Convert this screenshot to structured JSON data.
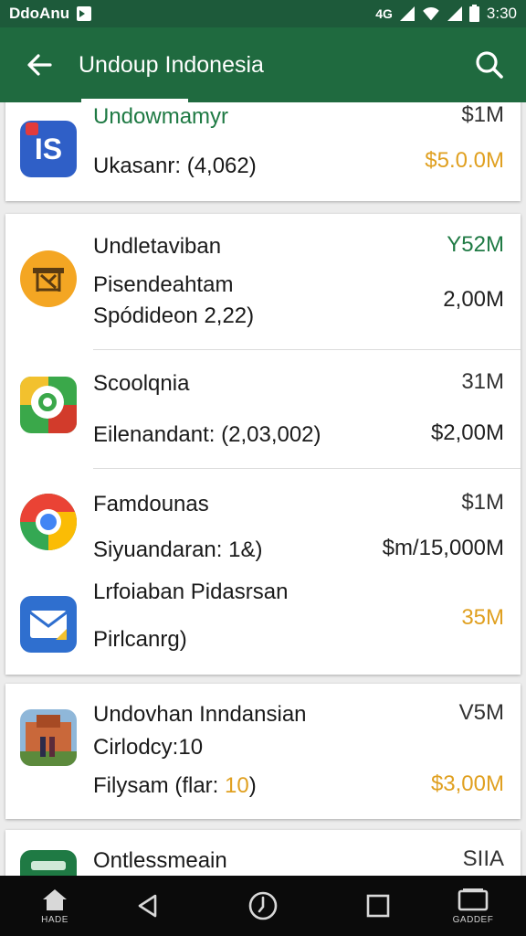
{
  "status_bar": {
    "carrier": "DdoAnu",
    "network": "4G",
    "time": "3:30"
  },
  "app_bar": {
    "title": "Undoup Indonesia"
  },
  "rows": [
    {
      "name": "Undowmamyr",
      "detail": "Ukasanr: (4,062)",
      "value1": "$1M",
      "value2": "$5.0.0M",
      "icon": "is-app-icon"
    },
    {
      "name": "Undletaviban",
      "detail": "Pisendeahtam",
      "detail2": "Spódideon 2,22)",
      "value1": "Y52M",
      "value2": "2,00M",
      "icon": "warehouse-app-icon"
    },
    {
      "name": "Scoolqnia",
      "detail": "Eilenandant: (2,03,002)",
      "value1": "31M",
      "value2": "$2,00M",
      "icon": "maps-pin-app-icon"
    },
    {
      "name": "Famdounas",
      "detail": "Siyuandaran: 1&)",
      "value1": "$1M",
      "value2": "$m/15,000M",
      "icon": "chrome-app-icon"
    },
    {
      "name": "Lrfoiaban Pidasrsan",
      "detail": "Pirlcanrg)",
      "value2": "35M",
      "icon": "mail-app-icon"
    },
    {
      "name": "Undovhan Inndansian",
      "detail": "Cirlodcy:10",
      "detail3_prefix": "Filysam (flar: ",
      "detail3_highlight": "10",
      "detail3_suffix": ")",
      "value1": "V5M",
      "value2": "$3,00M",
      "icon": "building-photo-app-icon"
    },
    {
      "name": "Ontlessmeain",
      "value1": "SIIA",
      "icon": "green-app-icon"
    }
  ],
  "nav_bar": {
    "home_label": "HADE",
    "recents_label": "GADDEF"
  },
  "colors": {
    "appbar": "#1f6a3f",
    "statusbar": "#1d5a3a",
    "accent_green": "#1f7a44",
    "accent_gold": "#e0a020"
  }
}
